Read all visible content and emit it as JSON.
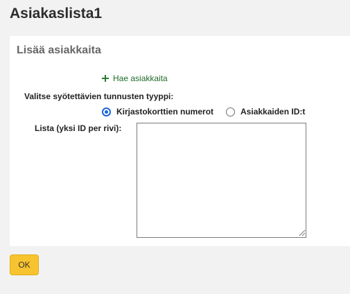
{
  "page": {
    "title": "Asiakaslista1"
  },
  "panel": {
    "title": "Lisää asiakkaita",
    "search_link_label": "Hae asiakkaita",
    "type_label": "Valitse syötettävien tunnusten tyyppi:",
    "radio_options": [
      {
        "label": "Kirjastokorttien numerot",
        "selected": true
      },
      {
        "label": "Asiakkaiden ID:t",
        "selected": false
      }
    ],
    "list_label": "Lista (yksi ID per rivi):",
    "list_value": ""
  },
  "footer": {
    "ok_label": "OK"
  },
  "colors": {
    "background": "#f1f2f1",
    "link": "#216b2a",
    "radio_selected": "#1a66d9",
    "ok_button": "#f7c32e"
  },
  "icons": [
    "plus-icon",
    "resize-grip-icon"
  ]
}
